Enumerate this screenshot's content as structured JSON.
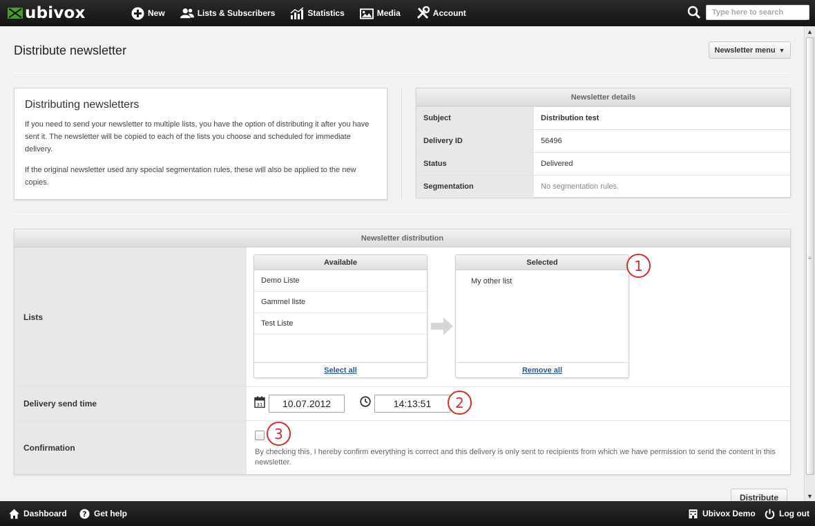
{
  "topnav": {
    "logo_text": "ubivox",
    "items": [
      {
        "label": "New",
        "icon": "plus-circle-icon"
      },
      {
        "label": "Lists & Subscribers",
        "icon": "users-icon"
      },
      {
        "label": "Statistics",
        "icon": "chart-icon"
      },
      {
        "label": "Media",
        "icon": "image-icon"
      },
      {
        "label": "Account",
        "icon": "tools-icon"
      }
    ],
    "search_placeholder": "Type here to search"
  },
  "page": {
    "title": "Distribute newsletter",
    "menu_button": "Newsletter menu",
    "menu_caret": "▼"
  },
  "info": {
    "heading": "Distributing newsletters",
    "paragraph1": "If you need to send your newsletter to multiple lists, you have the option of distributing it after you have sent it. The newsletter will be copied to each of the lists you choose and scheduled for immediate delivery.",
    "paragraph2": "If the original newsletter used any special segmentation rules, these will also be applied to the new copies."
  },
  "details": {
    "header": "Newsletter details",
    "rows": [
      {
        "key": "Subject",
        "value": "Distribution test"
      },
      {
        "key": "Delivery ID",
        "value": "56496"
      },
      {
        "key": "Status",
        "value": "Delivered"
      },
      {
        "key": "Segmentation",
        "value": "No segmentation rules."
      }
    ]
  },
  "distribution": {
    "header": "Newsletter distribution",
    "lists_label": "Lists",
    "available": {
      "title": "Available",
      "items": [
        "Demo Liste",
        "Gammel liste",
        "Test Liste"
      ],
      "footer_link": "Select all"
    },
    "selected": {
      "title": "Selected",
      "items": [
        "My other list"
      ],
      "footer_link": "Remove all"
    },
    "send_time_label": "Delivery send time",
    "date_value": "10.07.2012",
    "calendar_day": "31",
    "time_value": "14:13:51",
    "confirmation_label": "Confirmation",
    "confirmation_text": "By checking this, I hereby confirm everything is correct and this delivery is only sent to recipients from which we have permission to send the content in this newsletter.",
    "badges": [
      "1",
      "2",
      "3"
    ],
    "accent_color": "#d42a2a"
  },
  "actions": {
    "distribute": "Distribute"
  },
  "scrollbar": {
    "up": "▲",
    "down": "▼",
    "grip": "≡"
  },
  "bottombar": {
    "dashboard": "Dashboard",
    "help": "Get help",
    "account_name": "Ubivox Demo",
    "logout": "Log out"
  }
}
